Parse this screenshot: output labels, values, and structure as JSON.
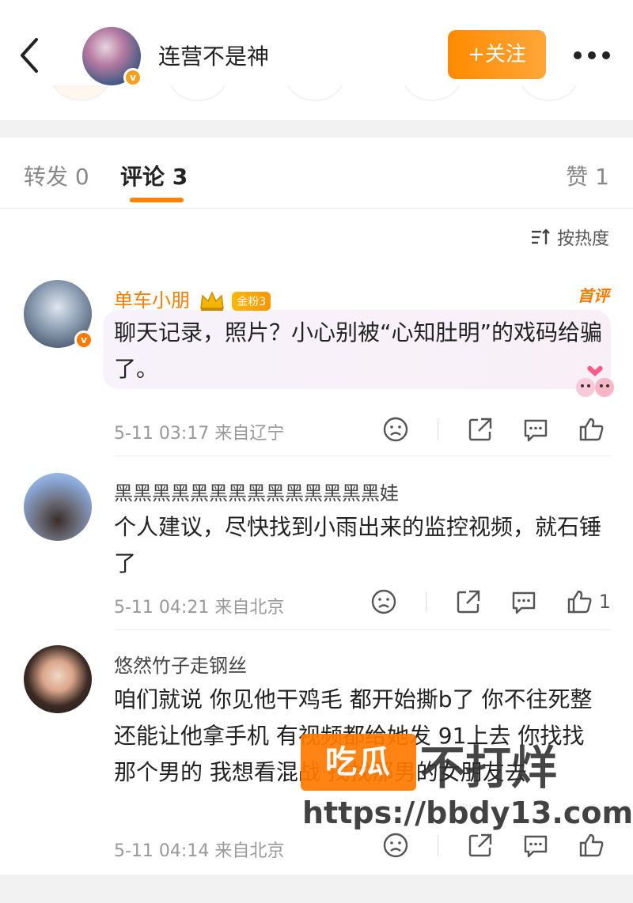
{
  "header": {
    "user_name": "连营不是神",
    "follow_label": "+关注",
    "avatar_badge": "v"
  },
  "tabs": {
    "repost": "转发 0",
    "comments": "评论 3",
    "likes": "赞 1"
  },
  "sort_label": "按热度",
  "comments": [
    {
      "name": "单车小朋",
      "fan_badge": "金粉3",
      "tag": "首评",
      "text": "聊天记录，照片？小心别被“心知肚明”的戏码给骗了。",
      "time": "5-11 03:17",
      "location": "来自辽宁",
      "likes": ""
    },
    {
      "name": "黑黑黑黑黑黑黑黑黑黑黑黑黑黑娃",
      "text": "个人建议，尽快找到小雨出来的监控视频，就石锤了",
      "time": "5-11 04:21",
      "location": "来自北京",
      "likes": "1"
    },
    {
      "name": "悠然竹子走钢丝",
      "text": "咱们就说 你见他干鸡毛 都开始撕b了 你不往死整 还能让他拿手机 有视频都给她发 91上去 你找找那个男的 我想看混战 找找那男的女朋友去",
      "time": "5-11 04:14",
      "location": "来自北京",
      "likes": ""
    }
  ],
  "watermark": {
    "box_text": "吃瓜",
    "big_text": "不打烊",
    "url": "https://bbdy13.com"
  },
  "colors": {
    "accent": "#ff8200",
    "follow_bg": "#ff9a1a",
    "verified": "#f4a11f"
  }
}
